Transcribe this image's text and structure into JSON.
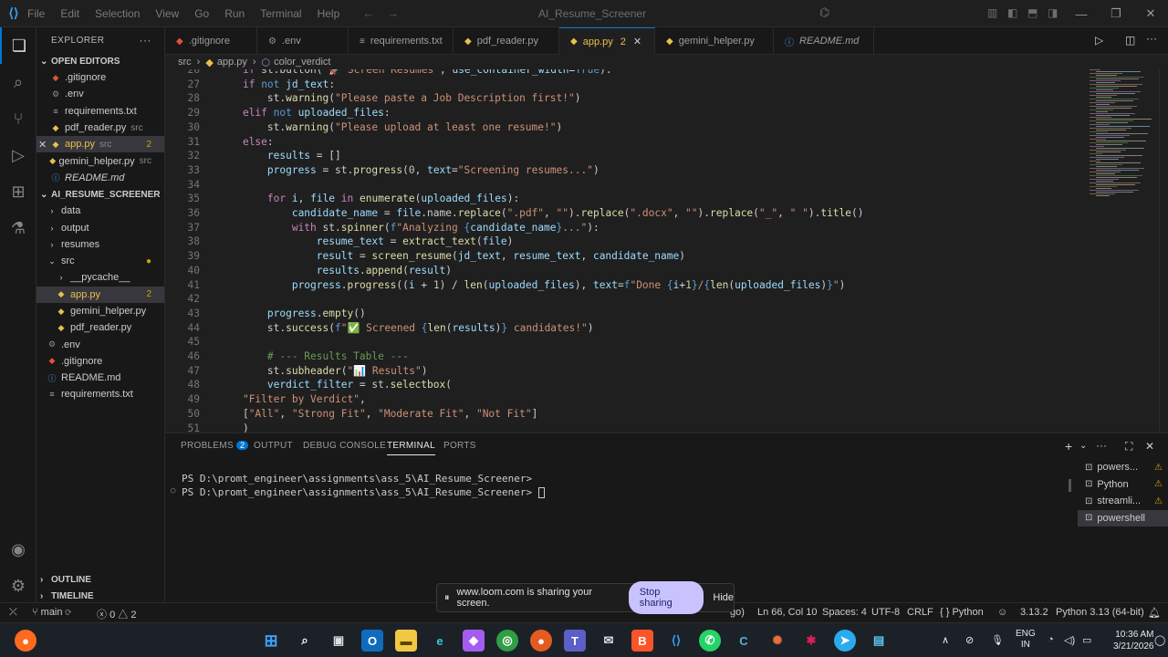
{
  "menu": [
    "File",
    "Edit",
    "Selection",
    "View",
    "Go",
    "Run",
    "Terminal",
    "Help"
  ],
  "window_title": "AI_Resume_Screener",
  "sidebar": {
    "title": "EXPLORER",
    "open_editors_label": "OPEN EDITORS",
    "open_editors": [
      {
        "name": ".gitignore",
        "desc": "",
        "count": "",
        "type": "git"
      },
      {
        "name": ".env",
        "desc": "",
        "count": "",
        "type": "gear"
      },
      {
        "name": "requirements.txt",
        "desc": "",
        "count": "",
        "type": "txt"
      },
      {
        "name": "pdf_reader.py",
        "desc": "src",
        "count": "",
        "type": "py"
      },
      {
        "name": "app.py",
        "desc": "src",
        "count": "2",
        "type": "py"
      },
      {
        "name": "gemini_helper.py",
        "desc": "src",
        "count": "",
        "type": "py"
      },
      {
        "name": "README.md",
        "desc": "",
        "count": "",
        "type": "md"
      }
    ],
    "project_label": "AI_RESUME_SCREENER",
    "tree": [
      {
        "name": "data",
        "indent": 1,
        "type": "folder",
        "count": ""
      },
      {
        "name": "output",
        "indent": 1,
        "type": "folder",
        "count": ""
      },
      {
        "name": "resumes",
        "indent": 1,
        "type": "folder",
        "count": ""
      },
      {
        "name": "src",
        "indent": 1,
        "type": "folder-open",
        "count": "●"
      },
      {
        "name": "__pycache__",
        "indent": 2,
        "type": "folder",
        "count": ""
      },
      {
        "name": "app.py",
        "indent": 2,
        "type": "py",
        "count": "2"
      },
      {
        "name": "gemini_helper.py",
        "indent": 2,
        "type": "py",
        "count": ""
      },
      {
        "name": "pdf_reader.py",
        "indent": 2,
        "type": "py",
        "count": ""
      },
      {
        "name": ".env",
        "indent": 1,
        "type": "gear",
        "count": ""
      },
      {
        "name": ".gitignore",
        "indent": 1,
        "type": "git",
        "count": ""
      },
      {
        "name": "README.md",
        "indent": 1,
        "type": "md",
        "count": ""
      },
      {
        "name": "requirements.txt",
        "indent": 1,
        "type": "txt",
        "count": ""
      }
    ],
    "outline_label": "OUTLINE",
    "timeline_label": "TIMELINE"
  },
  "tabs": [
    {
      "label": ".gitignore",
      "type": "git",
      "count": ""
    },
    {
      "label": ".env",
      "type": "gear",
      "count": ""
    },
    {
      "label": "requirements.txt",
      "type": "txt",
      "count": ""
    },
    {
      "label": "pdf_reader.py",
      "type": "py",
      "count": ""
    },
    {
      "label": "app.py",
      "type": "py",
      "count": "2"
    },
    {
      "label": "gemini_helper.py",
      "type": "py",
      "count": ""
    },
    {
      "label": "README.md",
      "type": "md",
      "count": ""
    }
  ],
  "breadcrumb": [
    "src",
    "app.py",
    "color_verdict"
  ],
  "code_lines": [
    {
      "n": "26",
      "html": "    <span class='k'>if</span> st.button(<span class='s'>\"🚀 Screen Resumes\"</span>, <span class='v'>use_container_width</span>=<span class='b'>True</span>):"
    },
    {
      "n": "27",
      "html": "    <span class='k'>if</span> <span class='b'>not</span> <span class='v'>jd_text</span>:"
    },
    {
      "n": "28",
      "html": "        st.<span class='f'>warning</span>(<span class='s'>\"Please paste a Job Description first!\"</span>)"
    },
    {
      "n": "29",
      "html": "    <span class='k'>elif</span> <span class='b'>not</span> <span class='v'>uploaded_files</span>:"
    },
    {
      "n": "30",
      "html": "        st.<span class='f'>warning</span>(<span class='s'>\"Please upload at least one resume!\"</span>)"
    },
    {
      "n": "31",
      "html": "    <span class='k'>else</span>:"
    },
    {
      "n": "32",
      "html": "        <span class='v'>results</span> = []"
    },
    {
      "n": "33",
      "html": "        <span class='v'>progress</span> = st.<span class='f'>progress</span>(<span class='n'>0</span>, <span class='v'>text</span>=<span class='s'>\"Screening resumes...\"</span>)"
    },
    {
      "n": "34",
      "html": ""
    },
    {
      "n": "35",
      "html": "        <span class='k'>for</span> <span class='v'>i</span>, <span class='v'>file</span> <span class='k'>in</span> <span class='f'>enumerate</span>(<span class='v'>uploaded_files</span>):"
    },
    {
      "n": "36",
      "html": "            <span class='v'>candidate_name</span> = <span class='v'>file</span>.name.<span class='f'>replace</span>(<span class='s'>\".pdf\"</span>, <span class='s'>\"\"</span>).<span class='f'>replace</span>(<span class='s'>\".docx\"</span>, <span class='s'>\"\"</span>).<span class='f'>replace</span>(<span class='s'>\"_\"</span>, <span class='s'>\" \"</span>).<span class='f'>title</span>()"
    },
    {
      "n": "37",
      "html": "            <span class='k'>with</span> st.<span class='f'>spinner</span>(<span class='b'>f</span><span class='s'>\"Analyzing </span><span class='b'>{</span><span class='v'>candidate_name</span><span class='b'>}</span><span class='s'>...\"</span>):"
    },
    {
      "n": "38",
      "html": "                <span class='v'>resume_text</span> = <span class='f'>extract_text</span>(<span class='v'>file</span>)"
    },
    {
      "n": "39",
      "html": "                <span class='v'>result</span> = <span class='f'>screen_resume</span>(<span class='v'>jd_text</span>, <span class='v'>resume_text</span>, <span class='v'>candidate_name</span>)"
    },
    {
      "n": "40",
      "html": "                <span class='v'>results</span>.<span class='f'>append</span>(<span class='v'>result</span>)"
    },
    {
      "n": "41",
      "html": "            <span class='v'>progress</span>.<span class='f'>progress</span>((<span class='v'>i</span> + <span class='n'>1</span>) / <span class='f'>len</span>(<span class='v'>uploaded_files</span>), <span class='v'>text</span>=<span class='b'>f</span><span class='s'>\"Done </span><span class='b'>{</span><span class='v'>i</span>+<span class='n'>1</span><span class='b'>}</span><span class='s'>/</span><span class='b'>{</span><span class='f'>len</span>(<span class='v'>uploaded_files</span>)<span class='b'>}</span><span class='s'>\"</span>)"
    },
    {
      "n": "42",
      "html": ""
    },
    {
      "n": "43",
      "html": "        <span class='v'>progress</span>.<span class='f'>empty</span>()"
    },
    {
      "n": "44",
      "html": "        st.<span class='f'>success</span>(<span class='b'>f</span><span class='s'>\"✅ Screened </span><span class='b'>{</span><span class='f'>len</span>(<span class='v'>results</span>)<span class='b'>}</span><span class='s'> candidates!\"</span>)"
    },
    {
      "n": "45",
      "html": ""
    },
    {
      "n": "46",
      "html": "        <span class='c'># --- Results Table ---</span>"
    },
    {
      "n": "47",
      "html": "        st.<span class='f'>subheader</span>(<span class='s'>\"📊 Results\"</span>)"
    },
    {
      "n": "48",
      "html": "        <span class='v'>verdict_filter</span> = st.<span class='f'>selectbox</span>("
    },
    {
      "n": "49",
      "html": "    <span class='s'>\"Filter by Verdict\"</span>,"
    },
    {
      "n": "50",
      "html": "    [<span class='s'>\"All\"</span>, <span class='s'>\"Strong Fit\"</span>, <span class='s'>\"Moderate Fit\"</span>, <span class='s'>\"Not Fit\"</span>]"
    },
    {
      "n": "51",
      "html": "    )"
    }
  ],
  "panel": {
    "tabs": [
      "PROBLEMS",
      "OUTPUT",
      "DEBUG CONSOLE",
      "TERMINAL",
      "PORTS"
    ],
    "problems_count": "2",
    "terminal_lines": [
      "PS D:\\promt_engineer\\assignments\\ass_5\\AI_Resume_Screener> ",
      "PS D:\\promt_engineer\\assignments\\ass_5\\AI_Resume_Screener> "
    ],
    "terminals": [
      "powers...",
      "Python",
      "streamli...",
      "powershell"
    ]
  },
  "status": {
    "branch": "main",
    "errors": "0",
    "warnings": "2",
    "position": "Ln 66, Col 10",
    "spaces": "Spaces: 4",
    "encoding": "UTF-8",
    "eol": "CRLF",
    "language": "Python",
    "version": "3.13.2",
    "interpreter": "Python 3.13 (64-bit)",
    "partial_hidden": "go)"
  },
  "loom": {
    "message": "www.loom.com is sharing your screen.",
    "stop_label": "Stop sharing",
    "hide_label": "Hide"
  },
  "taskbar": {
    "lang": "ENG",
    "region": "IN",
    "time": "10:36 AM",
    "date": "3/21/2026"
  }
}
